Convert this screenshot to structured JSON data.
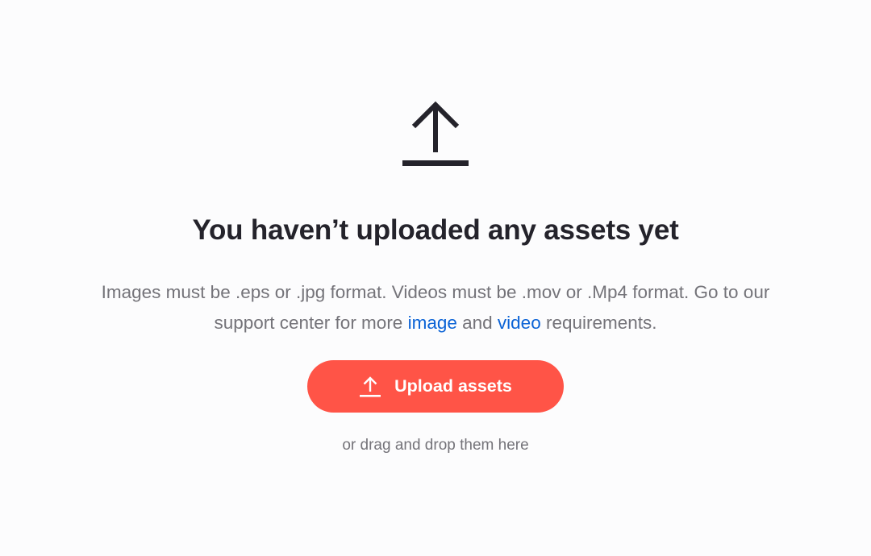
{
  "empty_state": {
    "icon": "upload-icon",
    "title": "You haven’t uploaded any assets yet",
    "description": {
      "part1": "Images must be .eps or .jpg format. Videos must be .mov or .Mp4 format. Go to our support center for more ",
      "image_link": "image",
      "part2": " and ",
      "video_link": "video",
      "part3": " requirements."
    },
    "upload_button": {
      "icon": "upload-icon",
      "label": "Upload assets"
    },
    "hint": "or drag and drop them here"
  },
  "colors": {
    "background": "#fcfcfd",
    "heading": "#24232b",
    "body_text": "#747379",
    "link": "#0b63d6",
    "button": "#ff5447",
    "button_text": "#ffffff"
  }
}
